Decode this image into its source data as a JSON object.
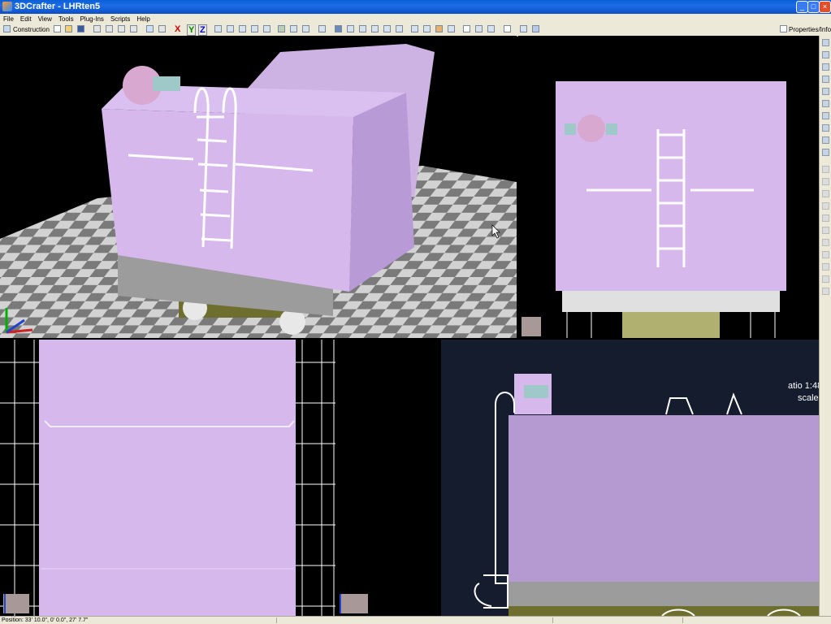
{
  "window": {
    "title": "3DCrafter - LHRten5"
  },
  "menu": [
    "File",
    "Edit",
    "View",
    "Tools",
    "Plug-Ins",
    "Scripts",
    "Help"
  ],
  "toolbar": {
    "construction_label": "Construction",
    "axis_x": "X",
    "axis_y": "Y",
    "axis_z": "Z",
    "properties_label": "Properties/Info",
    "colors": {
      "x": "#cc0000",
      "y": "#008800",
      "z": "#0000cc"
    }
  },
  "blueprint": {
    "text_line1": "atio 1:48",
    "text_line2": "scale"
  },
  "status": {
    "position": "Position: 33' 10.0\", 0' 0.0\", 27' 7.7\""
  },
  "colors": {
    "model": "#d6b8ec",
    "model_bp": "#b49ad0",
    "base": "#9c9c9c",
    "olive": "#6e6e2e",
    "blueprint_bg": "#141c2e"
  }
}
